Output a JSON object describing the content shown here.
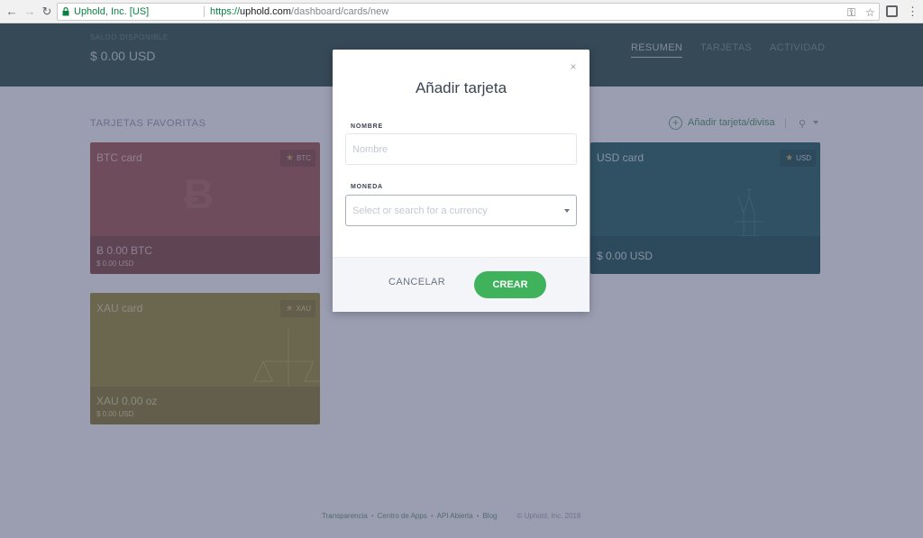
{
  "browser": {
    "site_identity": "Uphold, Inc. [US]",
    "url_proto": "https://",
    "url_host": "uphold.com",
    "url_path": "/dashboard/cards/new"
  },
  "header": {
    "balance_label": "SALDO DISPONIBLE",
    "balance_value": "$ 0.00 USD",
    "tabs": [
      {
        "label": "RESUMEN",
        "active": true
      },
      {
        "label": "TARJETAS",
        "active": false
      },
      {
        "label": "ACTIVIDAD",
        "active": false
      }
    ]
  },
  "content": {
    "section_title": "TARJETAS FAVORITAS",
    "add_link_label": "Añadir tarjeta/divisa",
    "cards": [
      {
        "title": "BTC card",
        "badge": "BTC",
        "amount": "Ƀ 0.00 BTC",
        "sub": "$ 0.00 USD"
      },
      {
        "title": "USD card",
        "badge": "USD",
        "amount": "$ 0.00 USD",
        "sub": ""
      },
      {
        "title": "XAU card",
        "badge": "XAU",
        "amount": "XAU 0.00 oz",
        "sub": "$ 0.00 USD"
      }
    ]
  },
  "footer": {
    "links": [
      "Transparencia",
      "Centro de Apps",
      "API Abierta",
      "Blog"
    ],
    "copyright": "© Uphold, Inc. 2018"
  },
  "modal": {
    "title": "Añadir tarjeta",
    "name_label": "NOMBRE",
    "name_placeholder": "Nombre",
    "name_value": "",
    "currency_label": "MONEDA",
    "currency_placeholder": "Select or search for a currency",
    "cancel_label": "CANCELAR",
    "create_label": "CREAR"
  },
  "colors": {
    "accent_green": "#3fb25b",
    "header_bg": "#3b5b54",
    "btc_card": "#a0615b",
    "usd_card": "#2f6b6b",
    "xau_card": "#9c9346"
  }
}
